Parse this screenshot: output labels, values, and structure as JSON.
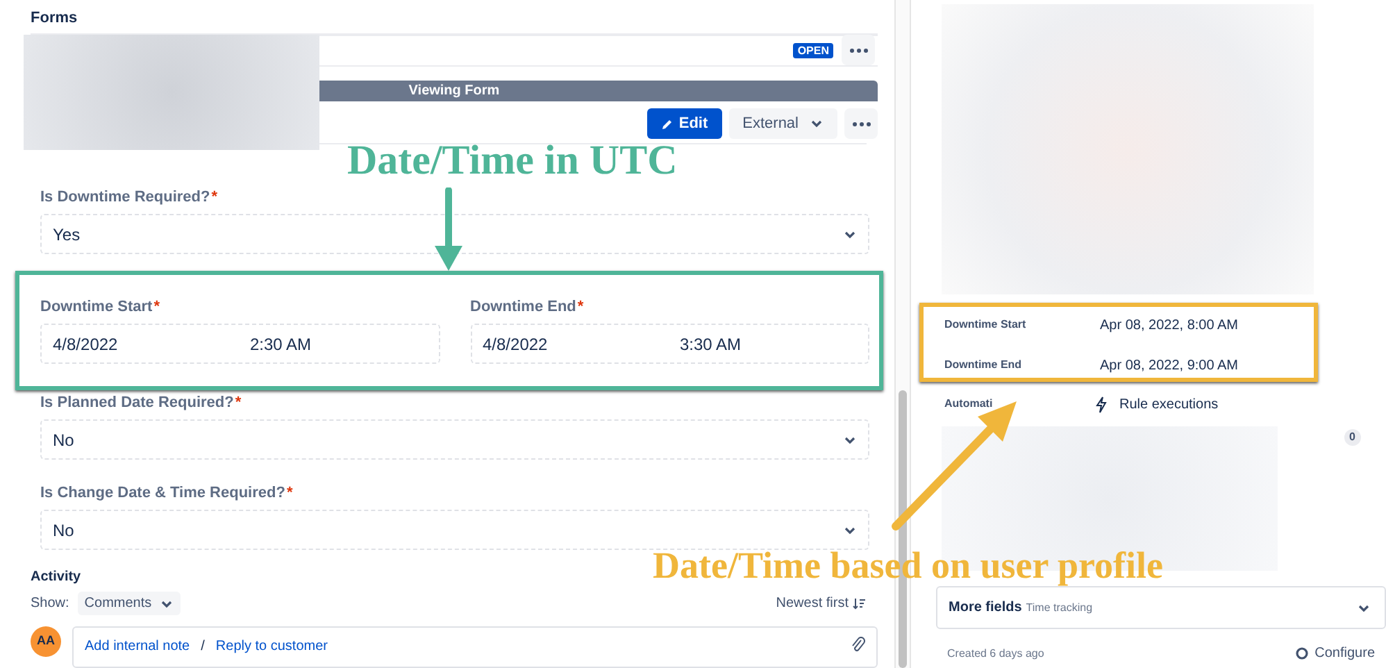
{
  "forms": {
    "title": "Forms",
    "status": "OPEN",
    "banner": "Viewing Form",
    "edit_button": "Edit",
    "visibility": "External",
    "fields": [
      {
        "kind": "select",
        "label": "Is Downtime Required?",
        "required_mark": "*",
        "value": "Yes"
      },
      {
        "kind": "datetime_pair",
        "items": [
          {
            "label": "Downtime Start",
            "required_mark": "*",
            "date": "4/8/2022",
            "time": "2:30 AM"
          },
          {
            "label": "Downtime End",
            "required_mark": "*",
            "date": "4/8/2022",
            "time": "3:30 AM"
          }
        ]
      },
      {
        "kind": "select",
        "label": "Is Planned Date Required?",
        "required_mark": "*",
        "value": "No"
      },
      {
        "kind": "select",
        "label": "Is Change Date & Time Required?",
        "required_mark": "*",
        "value": "No"
      }
    ]
  },
  "activity": {
    "title": "Activity",
    "show_label": "Show:",
    "filter": "Comments",
    "sort": "Newest first",
    "avatar": "AA",
    "links": [
      "Add internal note",
      "Reply to customer"
    ],
    "separator": "/"
  },
  "details": {
    "rows": [
      {
        "label": "Downtime Start",
        "value": "Apr 08, 2022, 8:00 AM"
      },
      {
        "label": "Downtime End",
        "value": "Apr 08, 2022, 9:00 AM"
      }
    ],
    "automation_label": "Automati",
    "automation_link": "Rule executions",
    "count": "0",
    "more_fields": "More fields",
    "more_fields_hint": "Time tracking",
    "created": "Created 6 days ago",
    "configure": "Configure"
  },
  "annotations": [
    {
      "kind": "utc",
      "text": "Date/Time in UTC",
      "color": "#4fb598"
    },
    {
      "kind": "profile",
      "text": "Date/Time based on user profile",
      "color": "#f0b63b"
    }
  ]
}
